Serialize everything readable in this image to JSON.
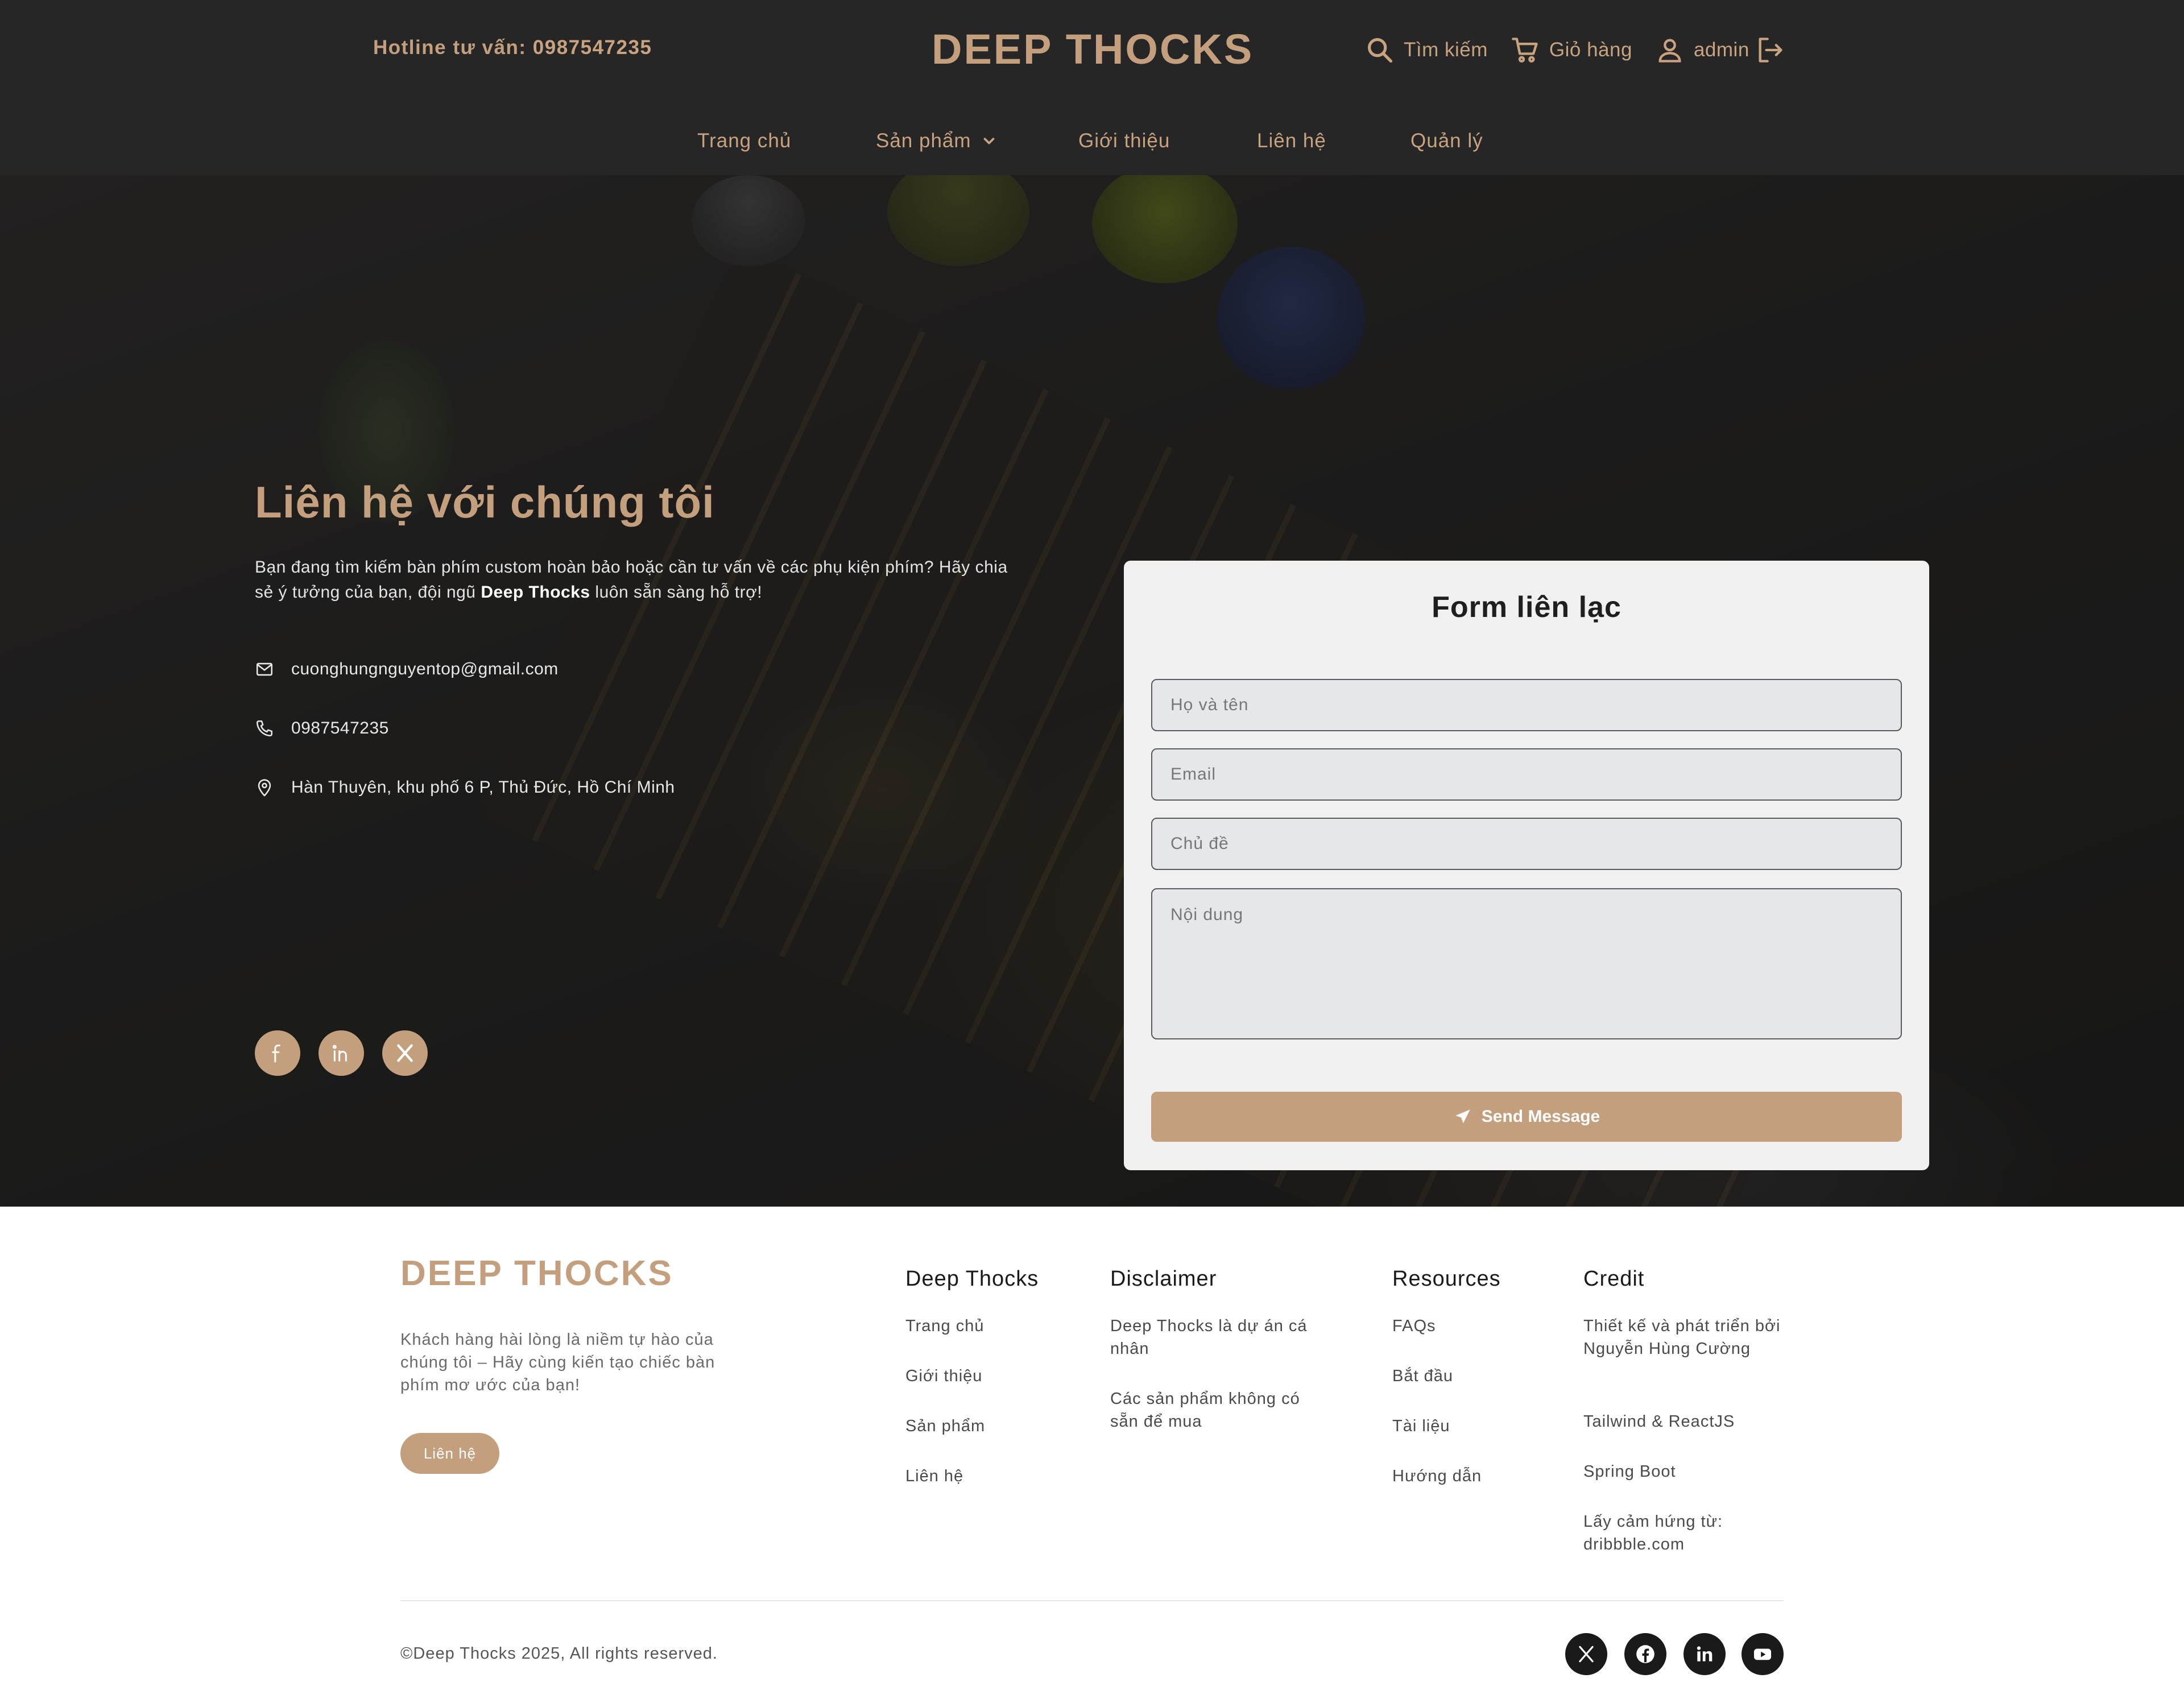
{
  "header": {
    "hotline_label": "Hotline tư vấn:",
    "hotline_number": "0987547235",
    "logo": "DEEP THOCKS",
    "search_label": "Tìm kiếm",
    "cart_label": "Giỏ hàng",
    "user_label": "admin"
  },
  "nav": {
    "items": [
      {
        "label": "Trang chủ"
      },
      {
        "label": "Sản phẩm"
      },
      {
        "label": "Giới thiệu"
      },
      {
        "label": "Liên hệ"
      },
      {
        "label": "Quản lý"
      }
    ]
  },
  "hero": {
    "title": "Liên hệ với chúng tôi",
    "desc_before": "Bạn đang tìm kiếm bàn phím custom hoàn bảo hoặc cần tư vấn về các phụ kiện phím? Hãy chia sẻ ý tưởng của bạn, đội ngũ ",
    "desc_brand": "Deep Thocks",
    "desc_after": " luôn sẵn sàng hỗ trợ!",
    "email": "cuonghungnguyentop@gmail.com",
    "phone": "0987547235",
    "address": "Hàn Thuyên, khu phố 6 P, Thủ Đức, Hồ Chí Minh"
  },
  "form": {
    "title": "Form liên lạc",
    "name_placeholder": "Họ và tên",
    "email_placeholder": "Email",
    "subject_placeholder": "Chủ đề",
    "message_placeholder": "Nội dung",
    "submit_label": "Send Message"
  },
  "footer": {
    "logo": "DEEP THOCKS",
    "tagline": "Khách hàng hài lòng là niềm tự hào của chúng tôi – Hãy cùng kiến tạo chiếc bàn phím mơ ước của bạn!",
    "cta_label": "Liên hệ",
    "columns": [
      {
        "title": "Deep Thocks",
        "links": [
          "Trang chủ",
          "Giới thiệu",
          "Sản phẩm",
          "Liên hệ"
        ]
      },
      {
        "title": "Disclaimer",
        "links": [
          "Deep Thocks là dự án cá nhân",
          "Các sản phẩm không có sẵn để mua"
        ]
      },
      {
        "title": "Resources",
        "links": [
          "FAQs",
          "Bắt đầu",
          "Tài liệu",
          "Hướng dẫn"
        ]
      },
      {
        "title": "Credit",
        "links": [
          "Thiết kế và phát triển bởi Nguyễn Hùng Cường",
          "Tailwind & ReactJS",
          "Spring Boot",
          "Lấy cảm hứng từ: dribbble.com"
        ]
      }
    ],
    "copyright": "©Deep Thocks 2025, All rights reserved."
  },
  "colors": {
    "accent": "#c39f7e",
    "header_bg": "#262626",
    "form_bg": "#f0f0f0"
  }
}
